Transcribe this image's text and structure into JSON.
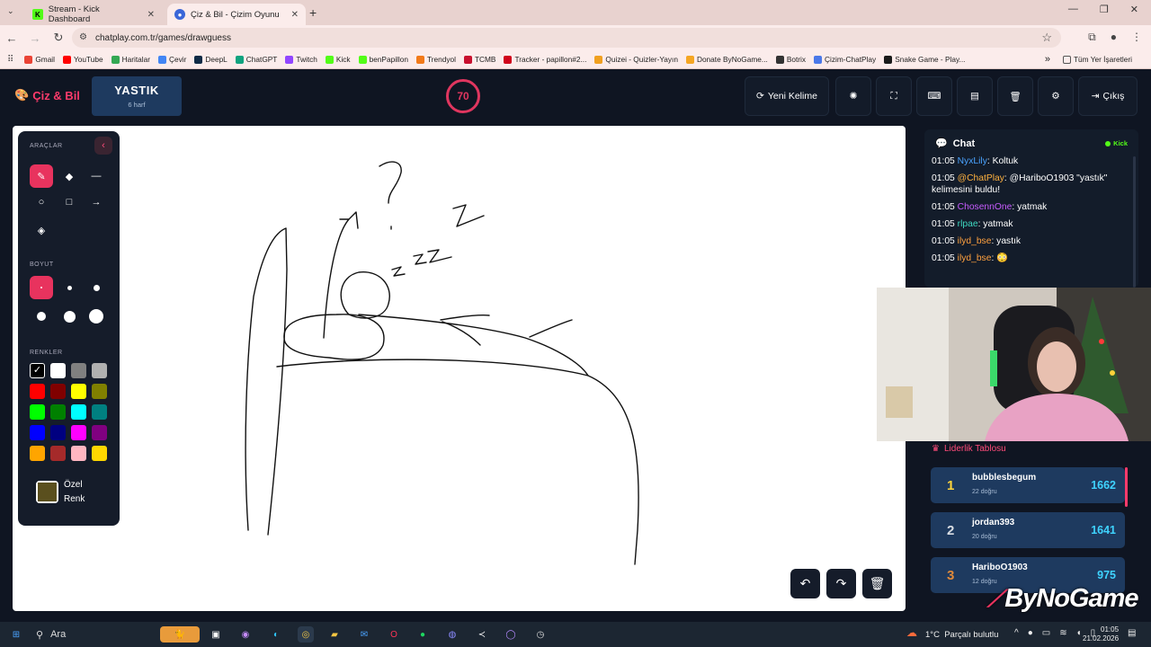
{
  "browser": {
    "tabs": [
      {
        "title": "Stream - Kick Dashboard",
        "icon": "kick-icon"
      },
      {
        "title": "Çiz & Bil - Çizim Oyunu",
        "icon": "chatplay-icon"
      }
    ],
    "url": "chatplay.com.tr/games/drawguess",
    "bookmarks": [
      "Gmail",
      "YouTube",
      "Haritalar",
      "Çevir",
      "DeepL",
      "ChatGPT",
      "Twitch",
      "Kick",
      "benPapillon",
      "Trendyol",
      "TCMB",
      "Tracker - papillon#2...",
      "Quizei - Quizler-Yayın",
      "Donate ByNoGame...",
      "Botrix",
      "Çizim-ChatPlay",
      "Snake Game - Play..."
    ],
    "all_bookmarks": "Tüm Yer İşaretleri"
  },
  "header": {
    "logo": "Çiz & Bil",
    "word": "YASTIK",
    "word_letters": "6 harf",
    "timer": "70",
    "new_word": "Yeni Kelime",
    "exit": "Çıkış"
  },
  "toolbox": {
    "tools_label": "ARAÇLAR",
    "size_label": "BOYUT",
    "colors_label": "RENKLER",
    "custom_color": "Özel Renk",
    "palette": [
      "#000000",
      "#ffffff",
      "#808080",
      "#b0b0b0",
      "#ff0000",
      "#800000",
      "#ffff00",
      "#808000",
      "#00ff00",
      "#008000",
      "#00ffff",
      "#008080",
      "#0000ff",
      "#000080",
      "#ff00ff",
      "#800080",
      "#ffa500",
      "#a52a2a",
      "#ffb6c1",
      "#ffd700"
    ],
    "selected_color": "#000000",
    "custom_color_value": "#5a4f1e"
  },
  "chat": {
    "title": "Chat",
    "platform": "Kick",
    "messages": [
      {
        "time": "01:05",
        "user": "NyxLily",
        "color": "#4aa3ff",
        "text": "Koltuk"
      },
      {
        "time": "01:05",
        "user": "@ChatPlay",
        "color": "#ffb23f",
        "text": "@HariboO1903 \"yastık\" kelimesini buldu!"
      },
      {
        "time": "01:05",
        "user": "ChosennOne",
        "color": "#c75cff",
        "text": "yatmak"
      },
      {
        "time": "01:05",
        "user": "rlpae",
        "color": "#3fd7c0",
        "text": "yatmak"
      },
      {
        "time": "01:05",
        "user": "ilyd_bse",
        "color": "#ffa13f",
        "text": "yastık"
      },
      {
        "time": "01:05",
        "user": "ilyd_bse",
        "color": "#ffa13f",
        "text": ""
      }
    ]
  },
  "leaderboard": {
    "title": "Liderlik Tablosu",
    "rows": [
      {
        "rank": "1",
        "name": "bubblesbegum",
        "correct": "22 doğru",
        "score": "1662",
        "rank_color": "#ffd43b"
      },
      {
        "rank": "2",
        "name": "jordan393",
        "correct": "20 doğru",
        "score": "1641",
        "rank_color": "#d9dde3"
      },
      {
        "rank": "3",
        "name": "HariboO1903",
        "correct": "12 doğru",
        "score": "975",
        "rank_color": "#e08a3a"
      }
    ]
  },
  "overlay": {
    "brand": "ByNoGame"
  },
  "taskbar": {
    "search": "Ara",
    "weather": "1°C  Parçalı bulutlu",
    "time": "01:05",
    "date": "21.02.2026"
  }
}
